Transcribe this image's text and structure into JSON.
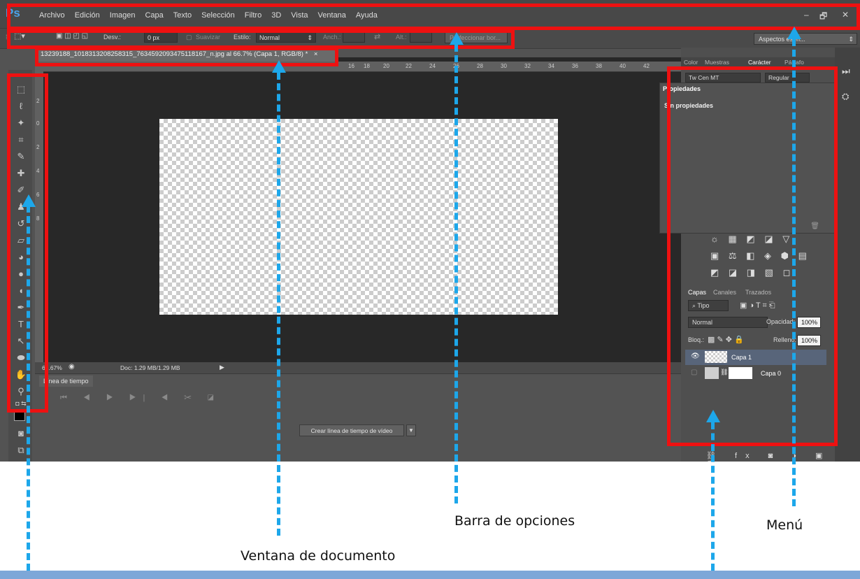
{
  "app": {
    "logo": "Ps"
  },
  "menu": [
    "Archivo",
    "Edición",
    "Imagen",
    "Capa",
    "Texto",
    "Selección",
    "Filtro",
    "3D",
    "Vista",
    "Ventana",
    "Ayuda"
  ],
  "window_controls": [
    "–",
    "🗗",
    "✕"
  ],
  "options_bar": {
    "desv_label": "Desv.:",
    "desv_value": "0 px",
    "suavizar": "Suavizar",
    "estilo_label": "Estilo:",
    "estilo_value": "Normal",
    "anch_label": "Anch.:",
    "alt_label": "Alt.:",
    "refine_button": "Perfeccionar bor..."
  },
  "workspace_select": "Aspectos esen...",
  "document": {
    "tab_title": "13239188_1018313208258315_763459209347511816​7_n.jpg al 66.7% (Capa 1, RGB/8) *",
    "close": "×",
    "zoom": "66.67%",
    "doc_size": "Doc: 1.29 MB/1.29 MB"
  },
  "ruler_ticks": [
    "16",
    "18",
    "20",
    "22",
    "24",
    "26",
    "28",
    "30",
    "32",
    "34",
    "36",
    "38",
    "40",
    "42"
  ],
  "ruler_left_ticks": [
    "2",
    "0",
    "2",
    "4",
    "6",
    "8"
  ],
  "timeline": {
    "tab": "Línea de tiempo",
    "create_button": "Crear línea de tiempo de vídeo"
  },
  "char_panel": {
    "tabs": [
      "Color",
      "Muestras",
      "Carácter",
      "Párrafo"
    ],
    "active_tab": "Carácter",
    "font_family": "Tw Cen MT",
    "font_style": "Regular"
  },
  "properties_panel": {
    "tab": "Propiedades",
    "text": "Sin propiedades"
  },
  "layers_panel": {
    "tabs": [
      "Capas",
      "Canales",
      "Trazados"
    ],
    "active_tab": "Capas",
    "filter": "Tipo",
    "blend_mode": "Normal",
    "opacity_label": "Opacidad:",
    "opacity_value": "100%",
    "lock_label": "Bloq.:",
    "fill_label": "Relleno:",
    "fill_value": "100%",
    "layers": [
      {
        "name": "Capa 1",
        "selected": true
      },
      {
        "name": "Capa 0",
        "selected": false
      }
    ]
  },
  "annotations": {
    "barra_opciones": "Barra de opciones",
    "menu": "Menú",
    "ventana_documento": "Ventana de documento"
  },
  "colors": {
    "highlight_red": "#ee1111",
    "arrow_blue": "#1da7ea",
    "ps_blue": "#4ba3ea"
  }
}
